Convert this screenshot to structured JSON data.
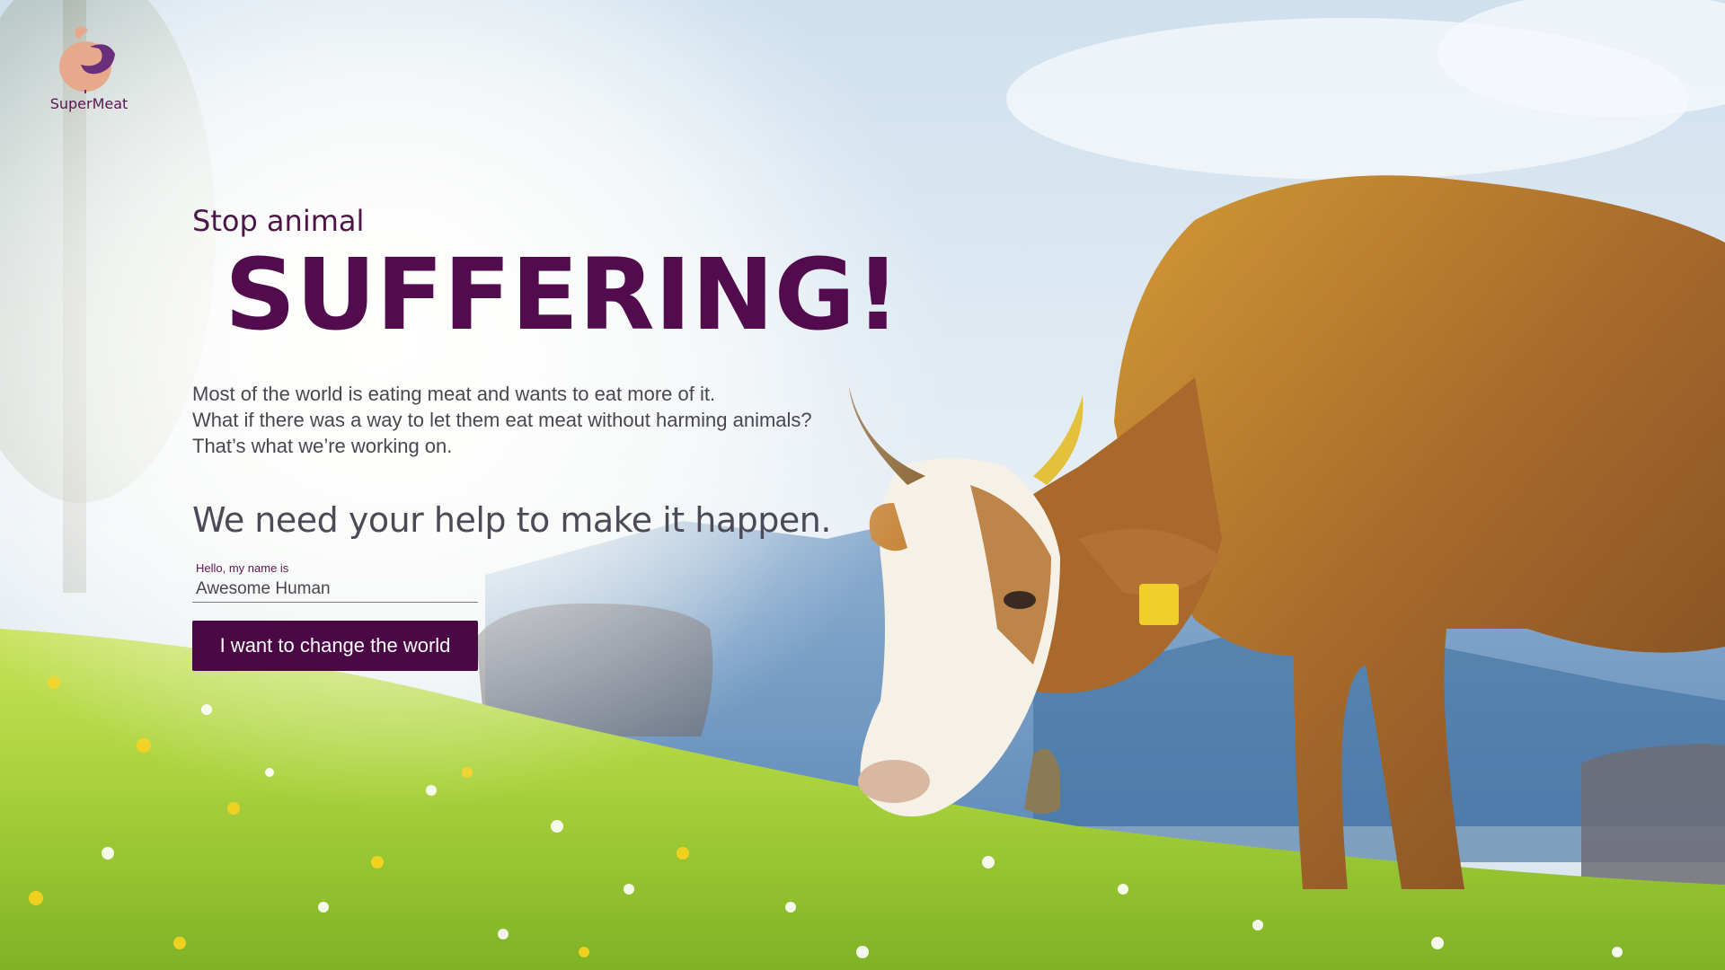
{
  "brand": {
    "name": "SuperMeat",
    "colors": {
      "primary": "#520b4d",
      "logo_peach": "#e6a98c",
      "logo_purple": "#6b2e7a"
    }
  },
  "hero": {
    "eyebrow": "Stop animal",
    "headline": "SUFFERING!",
    "intro_lines": [
      "Most of the world is eating meat and wants to eat more of it.",
      "What if there was a way to let them eat meat without harming animals?",
      "That’s what we’re working on."
    ],
    "call_to_action_text": "We need your help to make it happen."
  },
  "signup": {
    "name_label": "Hello, my name is",
    "name_placeholder": "Awesome Human",
    "submit_label": "I want to change the world"
  },
  "background": {
    "scene": "cow grazing on a sunny alpine meadow",
    "icons": [
      "supermeat-logo-icon"
    ]
  }
}
